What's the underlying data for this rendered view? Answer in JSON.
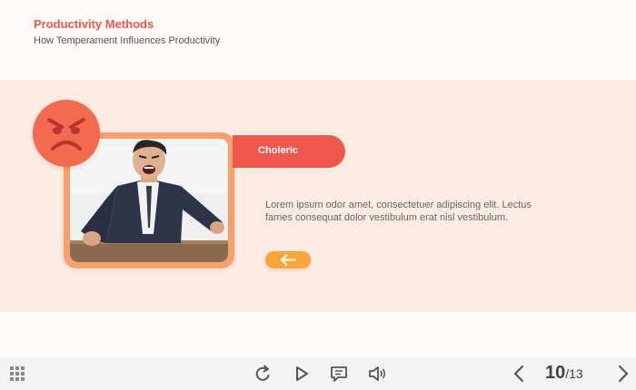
{
  "header": {
    "title": "Productivity Methods",
    "subtitle": "How Temperament Influences Productivity"
  },
  "slide": {
    "temperament_label": "Choleric",
    "body_text": "Lorem ipsum odor amet, consectetuer adipiscing elit. Lectus fames consequat dolor vestibulum erat nisl vestibulum.",
    "emoji_icon": "angry-face-icon",
    "back_icon": "arrow-left-icon"
  },
  "toolbar": {
    "menu_icon": "grid-menu-icon",
    "replay_icon": "replay-icon",
    "play_icon": "play-icon",
    "notes_icon": "comment-icon",
    "audio_icon": "speaker-icon",
    "prev_icon": "chevron-left-icon",
    "next_icon": "chevron-right-icon",
    "current_page": "10",
    "total_pages": "/13"
  },
  "colors": {
    "accent": "#f0574d",
    "orange": "#f26a4f",
    "button": "#f8a53b",
    "band": "#feebe2",
    "frame": "#f6a06b"
  }
}
